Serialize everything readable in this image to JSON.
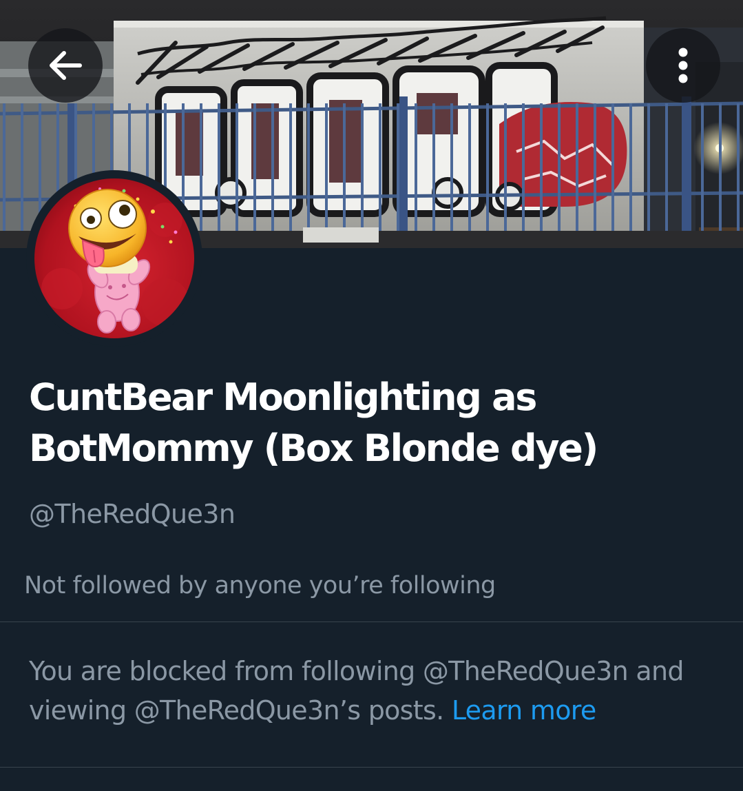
{
  "header": {
    "back_icon": "arrow-left-icon",
    "more_icon": "more-vertical-icon"
  },
  "banner": {
    "description_icon": "graffiti-wall-photo",
    "graffiti_text": "SLYOTFKOSMOE:SPLIN:WEZ"
  },
  "profile": {
    "avatar_icon": "zany-face-emoji-over-pink-bear-avatar",
    "display_name": "CuntBear Moonlighting as BotMommy (Box Blonde dye)",
    "handle": "@TheRedQue3n",
    "followers_you_know": "Not followed by anyone you’re following"
  },
  "blocked_notice": {
    "message": "You are blocked from following @TheRedQue3n and viewing @TheRedQue3n’s posts.",
    "link_label": "Learn more"
  },
  "colors": {
    "background": "#15202b",
    "secondary_text": "#8b98a5",
    "link": "#1d9bf0",
    "divider": "#38444d"
  }
}
